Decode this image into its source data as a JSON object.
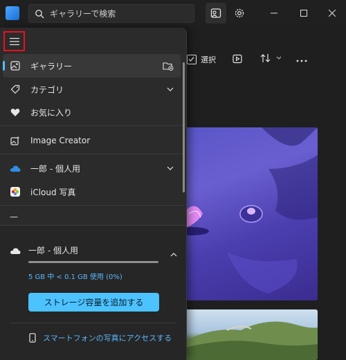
{
  "titlebar": {
    "search_placeholder": "ギャラリーで検索"
  },
  "toolbar": {
    "select_label": "選択"
  },
  "nav": {
    "items": [
      {
        "label": "ギャラリー"
      },
      {
        "label": "カテゴリ"
      },
      {
        "label": "お気に入り"
      },
      {
        "label": "Image Creator"
      },
      {
        "label": "一郎 - 個人用"
      },
      {
        "label": "iCloud 写真"
      },
      {
        "label": "—"
      }
    ]
  },
  "storage": {
    "account_label": "一郎 - 個人用",
    "usage_text": "5 GB 中 < 0.1 GB 使用 (0%)",
    "usage_fraction": 0.0,
    "add_button_label": "ストレージ容量を追加する",
    "phone_link_label": "スマートフォンの写真にアクセスする"
  },
  "colors": {
    "accent": "#4cc2ff",
    "highlight_border": "#e81123"
  }
}
